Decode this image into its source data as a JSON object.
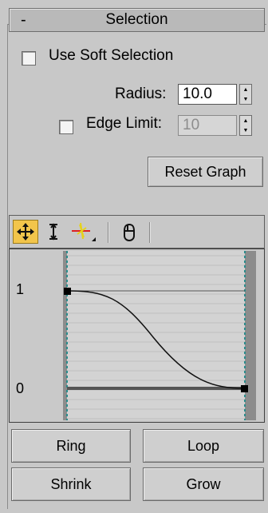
{
  "rollout": {
    "toggle": "-",
    "title": "Selection"
  },
  "soft_selection": {
    "label": "Use Soft Selection",
    "checked": false
  },
  "radius": {
    "label": "Radius:",
    "value": "10.0"
  },
  "edge_limit": {
    "label": "Edge Limit:",
    "value": "10",
    "checked": false
  },
  "reset_graph": {
    "label": "Reset Graph"
  },
  "toolbar": {
    "tools": [
      {
        "icon": "move-icon",
        "active": true
      },
      {
        "icon": "scale-vertical-icon",
        "active": false
      },
      {
        "icon": "insert-point-icon",
        "active": false
      },
      {
        "icon": "pan-icon",
        "active": false
      }
    ]
  },
  "graph": {
    "y_top_label": "1",
    "y_bottom_label": "0"
  },
  "buttons": {
    "ring": "Ring",
    "loop": "Loop",
    "shrink": "Shrink",
    "grow": "Grow"
  },
  "colors": {
    "active_tool": "#f2c54b",
    "guide_line": "#2a8c8c"
  }
}
